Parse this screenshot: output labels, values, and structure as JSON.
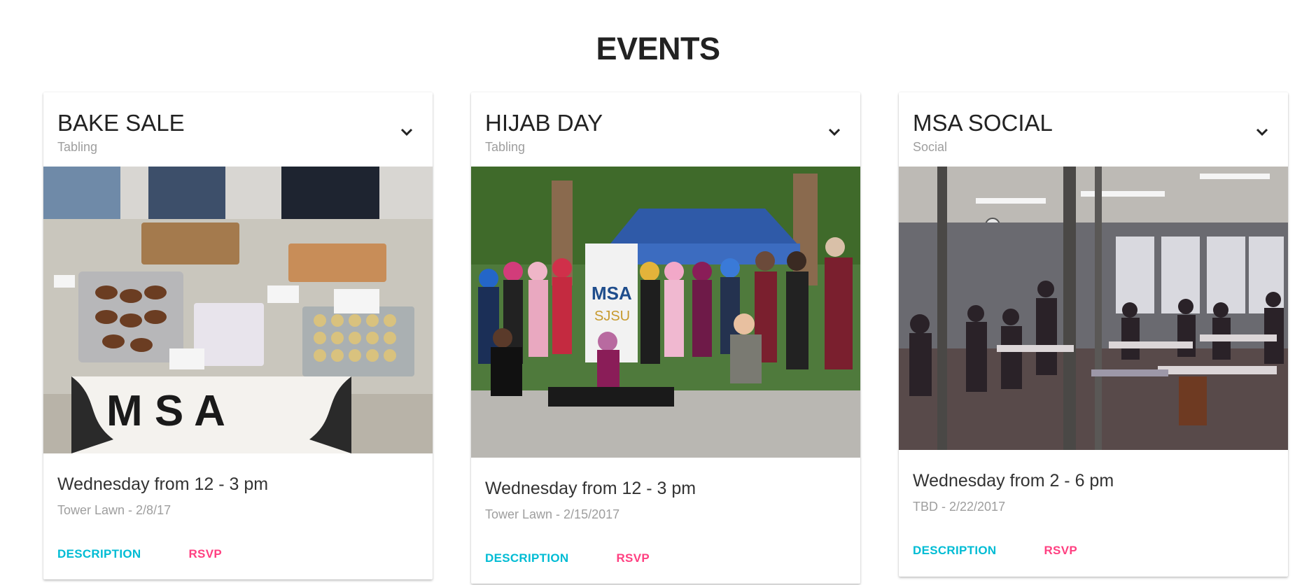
{
  "page": {
    "title": "EVENTS"
  },
  "colors": {
    "description_button": "#00bcd4",
    "rsvp_button": "#ff4081",
    "subtitle_gray": "#9e9e9e"
  },
  "events": [
    {
      "title": "BAKE SALE",
      "category": "Tabling",
      "image_description": "Bake sale table with baked goods and MSA Bake Sale sign",
      "time": "Wednesday from 12 - 3 pm",
      "location": "Tower Lawn - 2/8/17",
      "description_label": "DESCRIPTION",
      "rsvp_label": "RSVP",
      "expand_icon": "chevron-down-icon"
    },
    {
      "title": "HIJAB DAY",
      "category": "Tabling",
      "image_description": "Group photo of students with MSA SJSU banner under a blue tent",
      "time": "Wednesday from 12 - 3 pm",
      "location": "Tower Lawn - 2/15/2017",
      "description_label": "DESCRIPTION",
      "rsvp_label": "RSVP",
      "expand_icon": "chevron-down-icon"
    },
    {
      "title": "MSA SOCIAL",
      "category": "Social",
      "image_description": "Students gathered in a classroom viewed through glass windows",
      "time": "Wednesday from 2 - 6 pm",
      "location": "TBD - 2/22/2017",
      "description_label": "DESCRIPTION",
      "rsvp_label": "RSVP",
      "expand_icon": "chevron-down-icon"
    }
  ]
}
